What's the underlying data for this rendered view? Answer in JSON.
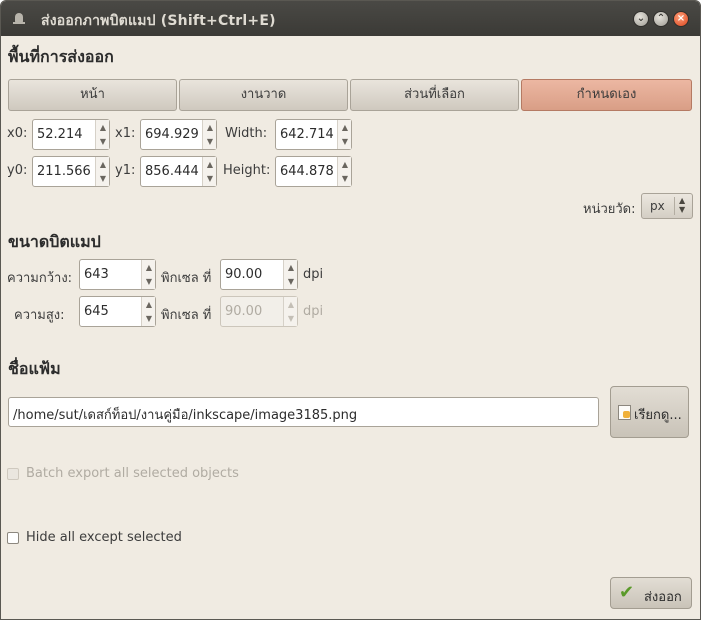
{
  "window": {
    "title": "ส่งออกภาพบิตแมป (Shift+Ctrl+E)",
    "controls": [
      "chevron-down-icon",
      "chevron-up-icon",
      "close-icon"
    ]
  },
  "export_area": {
    "heading": "พื้นที่การส่งออก",
    "tabs": [
      {
        "label": "หน้า",
        "active": false
      },
      {
        "label": "งานวาด",
        "active": false
      },
      {
        "label": "ส่วนที่เลือก",
        "active": false
      },
      {
        "label": "กำหนดเอง",
        "active": true
      }
    ],
    "x0_label": "x0:",
    "x0": "52.214",
    "x1_label": "x1:",
    "x1": "694.929",
    "width_label": "Width:",
    "width": "642.714",
    "y0_label": "y0:",
    "y0": "211.566",
    "y1_label": "y1:",
    "y1": "856.444",
    "height_label": "Height:",
    "height": "644.878",
    "units_label": "หน่วยวัด:",
    "units_value": "px"
  },
  "bitmap_size": {
    "heading": "ขนาดบิตแมป",
    "width_label": "ความกว้าง:",
    "width": "643",
    "width_pixels_at": "พิกเซล ที่",
    "width_dpi": "90.00",
    "width_dpi_unit": "dpi",
    "height_label": "ความสูง:",
    "height": "645",
    "height_pixels_at": "พิกเซล ที่",
    "height_dpi": "90.00",
    "height_dpi_unit": "dpi"
  },
  "filename": {
    "heading": "ชื่อแฟ้ม",
    "path": "/home/sut/เดสก์ท็อป/งานคู่มือ/inkscape/image3185.png",
    "browse_label": "เรียกดู..."
  },
  "options": {
    "batch_export_label": "Batch export all selected objects",
    "batch_export_checked": false,
    "batch_export_enabled": false,
    "hide_all_label": "Hide all except selected",
    "hide_all_checked": false
  },
  "export_button": {
    "label": "ส่งออก"
  },
  "colors": {
    "titlebar": "#3b3a36",
    "window_bg": "#f0ebe2",
    "active_tab": "#d99e86",
    "check_icon": "#5a9a2a"
  }
}
